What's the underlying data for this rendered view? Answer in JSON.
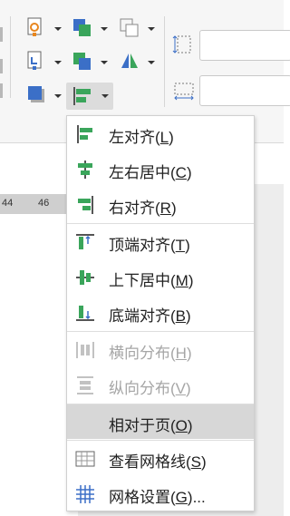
{
  "menu": {
    "items": [
      {
        "name": "左对齐",
        "key": "L",
        "icon": "align-left-icon",
        "enabled": true
      },
      {
        "name": "左右居中",
        "key": "C",
        "icon": "align-center-horizontal-icon",
        "enabled": true
      },
      {
        "name": "右对齐",
        "key": "R",
        "icon": "align-right-icon",
        "enabled": true
      },
      {
        "name": "顶端对齐",
        "key": "T",
        "icon": "align-top-icon",
        "enabled": true
      },
      {
        "name": "上下居中",
        "key": "M",
        "icon": "align-middle-vertical-icon",
        "enabled": true
      },
      {
        "name": "底端对齐",
        "key": "B",
        "icon": "align-bottom-icon",
        "enabled": true
      },
      {
        "name": "横向分布",
        "key": "H",
        "icon": "distribute-horizontal-icon",
        "enabled": false
      },
      {
        "name": "纵向分布",
        "key": "V",
        "icon": "distribute-vertical-icon",
        "enabled": false
      },
      {
        "name": "相对于页",
        "key": "O",
        "icon": "",
        "enabled": true,
        "highlighted": true
      },
      {
        "name": "查看网格线",
        "key": "S",
        "icon": "gridlines-view-icon",
        "enabled": true
      },
      {
        "name": "网格设置",
        "key": "G",
        "icon": "grid-settings-icon",
        "enabled": true,
        "ellipsis": "..."
      }
    ]
  },
  "ruler": {
    "labels": [
      "44",
      "46"
    ]
  },
  "toolbar": {
    "icons": [
      "shape-fill-icon",
      "bring-forward-icon",
      "group-icon",
      "shape-outline-icon",
      "send-backward-icon",
      "flip-icon",
      "shape-effects-icon",
      "align-icon",
      "width-icon",
      "height-icon"
    ]
  },
  "colors": {
    "accent": "#3aa55b",
    "blue": "#3b6fc7",
    "orange": "#e8861e",
    "highlight": "#d7d7d7",
    "disabled": "#a6a6a6"
  }
}
